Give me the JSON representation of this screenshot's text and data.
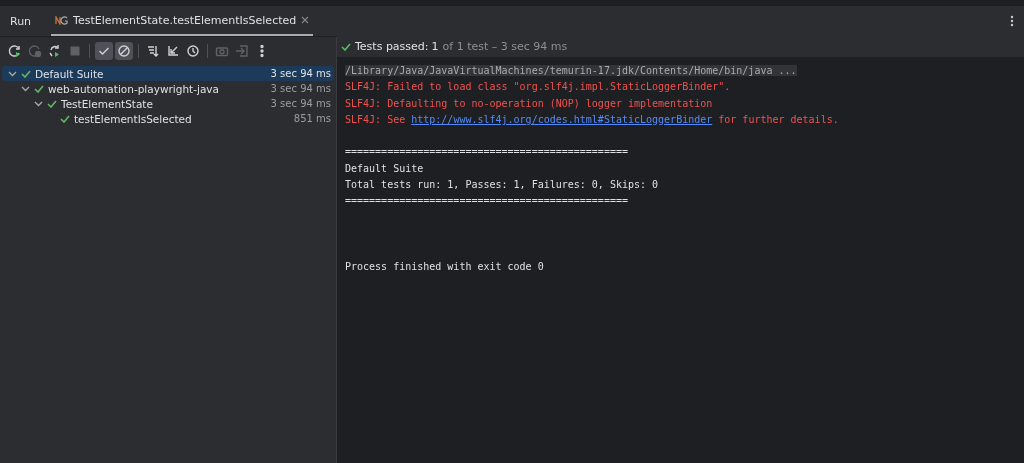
{
  "tool_window": {
    "title": "Run"
  },
  "tabs": [
    {
      "label": "TestElementState.testElementIsSelected",
      "selected": true
    }
  ],
  "toolbar": [
    {
      "kind": "rerun",
      "disabled": false,
      "on": false
    },
    {
      "kind": "rerun-failed",
      "disabled": true,
      "on": false
    },
    {
      "kind": "toggle-auto-test",
      "disabled": false,
      "on": false
    },
    {
      "kind": "stop",
      "disabled": true,
      "on": false
    },
    {
      "kind": "show-passed",
      "disabled": false,
      "on": true
    },
    {
      "kind": "show-ignored",
      "disabled": false,
      "on": true
    },
    {
      "kind": "sort",
      "disabled": false,
      "on": false
    },
    {
      "kind": "collapse",
      "disabled": false,
      "on": false
    },
    {
      "kind": "history",
      "disabled": false,
      "on": false
    },
    {
      "kind": "screenshot",
      "disabled": true,
      "on": false
    },
    {
      "kind": "export",
      "disabled": true,
      "on": false
    },
    {
      "kind": "more",
      "disabled": false,
      "on": false
    }
  ],
  "tree": [
    {
      "name": "Default Suite",
      "time": "3 sec 94 ms",
      "selected": true,
      "expanded": true,
      "children": [
        {
          "name": "web-automation-playwright-java",
          "time": "3 sec 94 ms",
          "selected": false,
          "expanded": true,
          "children": [
            {
              "name": "TestElementState",
              "time": "3 sec 94 ms",
              "selected": false,
              "expanded": true,
              "children": [
                {
                  "name": "testElementIsSelected",
                  "time": "851 ms",
                  "selected": false
                }
              ]
            }
          ]
        }
      ]
    }
  ],
  "status": {
    "label": "Tests passed:",
    "count": "1",
    "detail": "of 1 test – 3 sec 94 ms"
  },
  "console": [
    {
      "kind": "command",
      "text": "/Library/Java/JavaVirtualMachines/temurin-17.jdk/Contents/Home/bin/java ..."
    },
    {
      "kind": "error",
      "text": "SLF4J: Failed to load class \"org.slf4j.impl.StaticLoggerBinder\"."
    },
    {
      "kind": "error",
      "text": "SLF4J: Defaulting to no-operation (NOP) logger implementation"
    },
    {
      "kind": "error_link",
      "text": "SLF4J: See ",
      "link": "http://www.slf4j.org/codes.html#StaticLoggerBinder",
      "after": " for further details."
    },
    {
      "kind": "blank"
    },
    {
      "kind": "plain",
      "text": "==============================================="
    },
    {
      "kind": "plain",
      "text": "Default Suite"
    },
    {
      "kind": "plain",
      "text": "Total tests run: 1, Passes: 1, Failures: 0, Skips: 0"
    },
    {
      "kind": "plain",
      "text": "==============================================="
    },
    {
      "kind": "blank"
    },
    {
      "kind": "blank"
    },
    {
      "kind": "blank"
    },
    {
      "kind": "plain",
      "text": "Process finished with exit code 0"
    }
  ]
}
